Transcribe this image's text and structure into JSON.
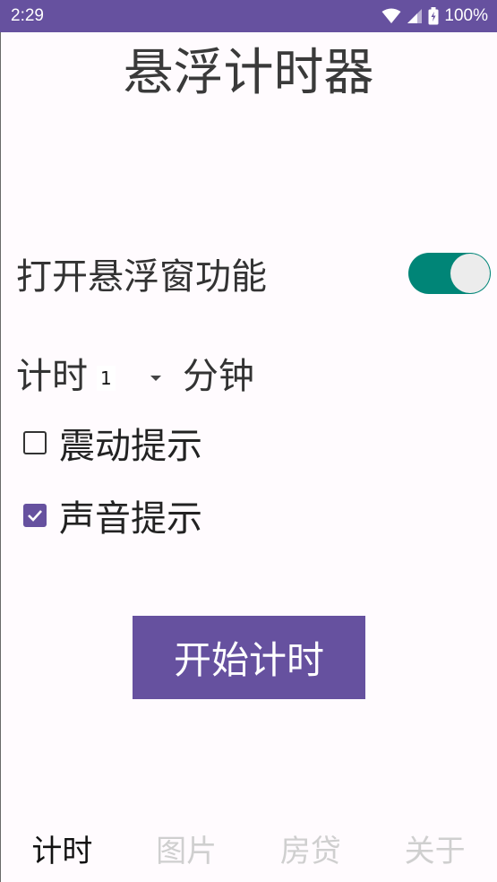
{
  "status_bar": {
    "time": "2:29",
    "battery": "100%"
  },
  "title": "悬浮计时器",
  "overlay": {
    "label": "打开悬浮窗功能",
    "enabled": true
  },
  "timer": {
    "prefix": "计时",
    "value": "1",
    "suffix": "分钟"
  },
  "options": [
    {
      "label": "震动提示",
      "checked": false
    },
    {
      "label": "声音提示",
      "checked": true
    }
  ],
  "start_button": "开始计时",
  "nav": {
    "tabs": [
      "计时",
      "图片",
      "房贷",
      "关于"
    ],
    "active": 0
  },
  "colors": {
    "primary": "#66519f",
    "switch_track": "#008577"
  }
}
